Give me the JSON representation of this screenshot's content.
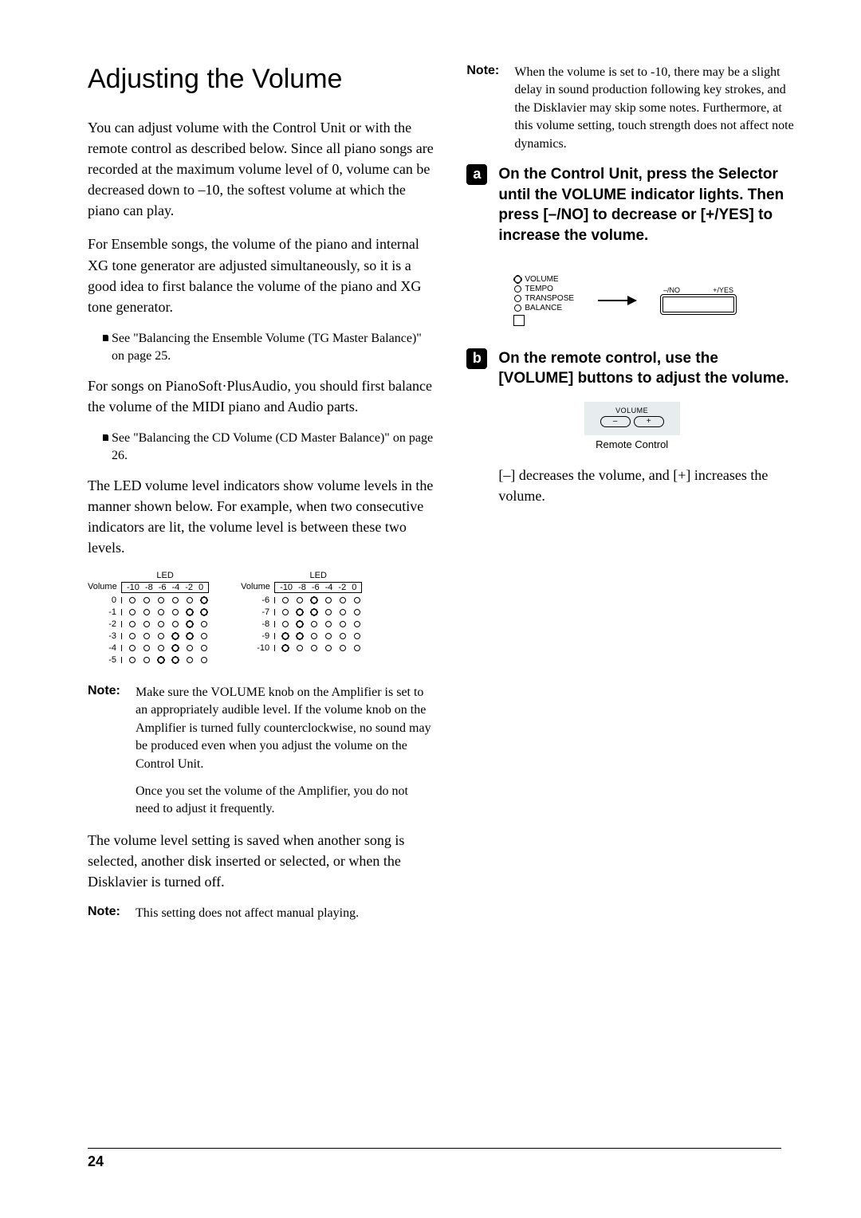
{
  "title": "Adjusting the Volume",
  "left": {
    "p1": "You can adjust volume with the Control Unit or with the remote control as described below. Since all piano songs are recorded at the maximum volume level of 0, volume can be decreased down to –10, the softest volume at which the piano can play.",
    "p2": "For Ensemble songs, the volume of the piano and internal XG tone generator are adjusted simultaneously, so it is a good idea to first balance the volume of the piano and XG tone generator.",
    "ref1": "See \"Balancing the Ensemble Volume (TG Master Balance)\" on page 25.",
    "p3": "For songs on PianoSoft·PlusAudio, you should first balance the volume of the MIDI piano and Audio parts.",
    "ref2": "See \"Balancing the CD Volume (CD Master Balance)\" on page 26.",
    "p4": "The LED volume level indicators show volume levels in the manner shown below.  For example, when two consecutive indicators are lit, the volume level is between these two levels.",
    "noteLabel": "Note:",
    "note1": "Make sure the VOLUME knob on the Amplifier is set to an appropriately audible level.  If the volume knob on the Amplifier is turned fully counterclockwise, no sound may be produced even when you adjust the volume on the Control Unit.",
    "note1b": "Once you set the volume of the Amplifier, you do not need to adjust it frequently.",
    "p5": "The volume level setting is saved when another song is selected, another disk inserted or selected, or when the Disklavier is turned off.",
    "note2": "This setting does not affect manual playing."
  },
  "right": {
    "noteLabel": "Note:",
    "noteTop": "When the volume is set to -10, there may be a slight delay in sound production following key strokes, and the Disklavier may skip some notes. Furthermore, at this volume setting, touch strength does not affect note dynamics.",
    "stepA": {
      "marker": "a",
      "title": "On the Control Unit, press the Selector until the VOLUME indicator lights. Then press [–/NO] to decrease or [+/YES] to increase the volume."
    },
    "selectorItems": [
      "VOLUME",
      "TEMPO",
      "TRANSPOSE",
      "BALANCE"
    ],
    "noYes": {
      "left": "–/NO",
      "right": "+/YES"
    },
    "stepB": {
      "marker": "b",
      "title": "On the remote control, use the [VOLUME] buttons to adjust the volume."
    },
    "remote": {
      "label": "VOLUME",
      "minus": "–",
      "plus": "+",
      "caption": "Remote Control"
    },
    "pB": "[–] decreases the volume, and [+] increases the volume."
  },
  "chart_data": {
    "type": "table",
    "title": "LED volume level indicators",
    "columns": [
      "-10",
      "-8",
      "-6",
      "-4",
      "-2",
      "0"
    ],
    "rows": [
      {
        "volume": 0,
        "lit": [
          0,
          0,
          0,
          0,
          0,
          1
        ]
      },
      {
        "volume": -1,
        "lit": [
          0,
          0,
          0,
          0,
          1,
          1
        ]
      },
      {
        "volume": -2,
        "lit": [
          0,
          0,
          0,
          0,
          1,
          0
        ]
      },
      {
        "volume": -3,
        "lit": [
          0,
          0,
          0,
          1,
          1,
          0
        ]
      },
      {
        "volume": -4,
        "lit": [
          0,
          0,
          0,
          1,
          0,
          0
        ]
      },
      {
        "volume": -5,
        "lit": [
          0,
          0,
          1,
          1,
          0,
          0
        ]
      },
      {
        "volume": -6,
        "lit": [
          0,
          0,
          1,
          0,
          0,
          0
        ]
      },
      {
        "volume": -7,
        "lit": [
          0,
          1,
          1,
          0,
          0,
          0
        ]
      },
      {
        "volume": -8,
        "lit": [
          0,
          1,
          0,
          0,
          0,
          0
        ]
      },
      {
        "volume": -9,
        "lit": [
          1,
          1,
          0,
          0,
          0,
          0
        ]
      },
      {
        "volume": -10,
        "lit": [
          1,
          0,
          0,
          0,
          0,
          0
        ]
      }
    ],
    "led_header": "LED",
    "volume_header": "Volume"
  },
  "pageNumber": "24"
}
